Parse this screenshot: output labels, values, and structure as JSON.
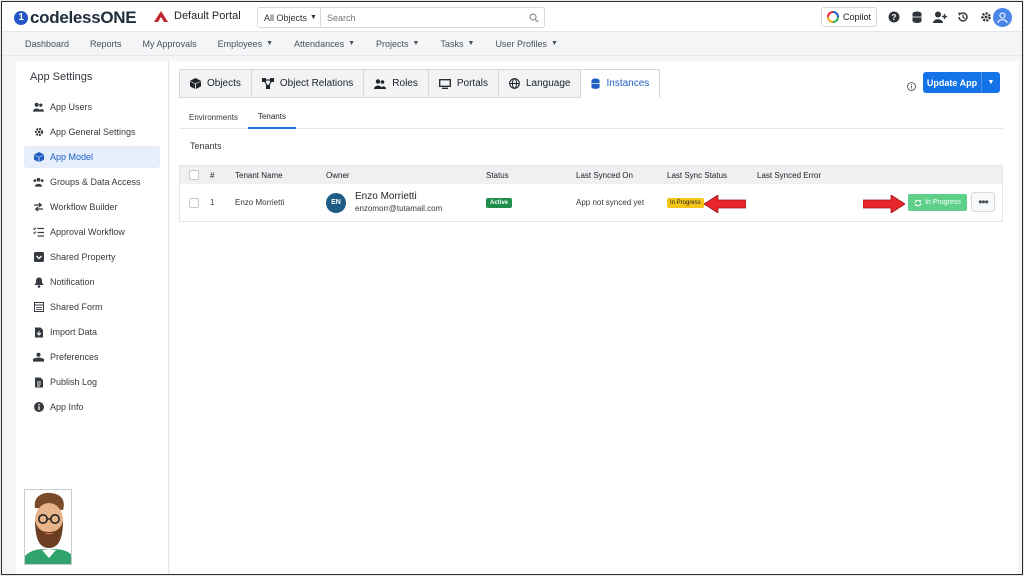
{
  "app": {
    "brand": "codelessONE",
    "portal": "Default Portal"
  },
  "search": {
    "object_filter": "All Objects",
    "placeholder": "Search"
  },
  "topbar": {
    "copilot_label": "Copilot",
    "icons": [
      "help-icon",
      "database-icon",
      "add-user-icon",
      "history-icon",
      "gear-icon",
      "user-avatar-icon"
    ]
  },
  "nav": {
    "items": [
      {
        "label": "Dashboard",
        "dropdown": false
      },
      {
        "label": "Reports",
        "dropdown": false
      },
      {
        "label": "My Approvals",
        "dropdown": false
      },
      {
        "label": "Employees",
        "dropdown": true
      },
      {
        "label": "Attendances",
        "dropdown": true
      },
      {
        "label": "Projects",
        "dropdown": true
      },
      {
        "label": "Tasks",
        "dropdown": true
      },
      {
        "label": "User Profiles",
        "dropdown": true
      }
    ]
  },
  "sidebar": {
    "title": "App Settings",
    "items": [
      {
        "label": "App Users",
        "icon": "users-icon"
      },
      {
        "label": "App General Settings",
        "icon": "gear-icon"
      },
      {
        "label": "App Model",
        "icon": "cube-icon",
        "active": true
      },
      {
        "label": "Groups & Data Access",
        "icon": "group-icon"
      },
      {
        "label": "Workflow Builder",
        "icon": "workflow-icon"
      },
      {
        "label": "Approval Workflow",
        "icon": "checklist-icon"
      },
      {
        "label": "Shared Property",
        "icon": "shared-property-icon"
      },
      {
        "label": "Notification",
        "icon": "bell-icon"
      },
      {
        "label": "Shared Form",
        "icon": "form-icon"
      },
      {
        "label": "Import Data",
        "icon": "import-icon"
      },
      {
        "label": "Preferences",
        "icon": "preferences-icon"
      },
      {
        "label": "Publish Log",
        "icon": "log-icon"
      },
      {
        "label": "App Info",
        "icon": "info-icon"
      }
    ]
  },
  "tabs": {
    "items": [
      {
        "label": "Objects",
        "icon": "cube-icon"
      },
      {
        "label": "Object Relations",
        "icon": "relations-icon"
      },
      {
        "label": "Roles",
        "icon": "roles-icon"
      },
      {
        "label": "Portals",
        "icon": "monitor-icon"
      },
      {
        "label": "Language",
        "icon": "globe-icon"
      },
      {
        "label": "Instances",
        "icon": "database-icon",
        "active": true
      }
    ]
  },
  "actions": {
    "update_label": "Update App"
  },
  "subtabs": {
    "items": [
      {
        "label": "Environments"
      },
      {
        "label": "Tenants",
        "active": true
      }
    ]
  },
  "section": {
    "title": "Tenants"
  },
  "table": {
    "headers": {
      "num": "#",
      "name": "Tenant Name",
      "owner": "Owner",
      "status": "Status",
      "synced_on": "Last Synced On",
      "sync_status": "Last Sync Status",
      "sync_error": "Last Synced Error"
    },
    "rows": [
      {
        "num": "1",
        "name": "Enzo Morrietti",
        "owner_initials": "EN",
        "owner_name": "Enzo Morrietti",
        "owner_email": "enzomorr@tutamail.com",
        "status": "Active",
        "synced_on": "App not synced yet",
        "sync_status": "In Progress",
        "sync_error": "",
        "action_label": "In Progress"
      }
    ]
  },
  "colors": {
    "primary": "#1473e6",
    "active_badge": "#1e8e4a",
    "progress_badge": "#f5c518",
    "progress_button": "#5fd08a",
    "annotation_arrow": "#e8262c"
  }
}
